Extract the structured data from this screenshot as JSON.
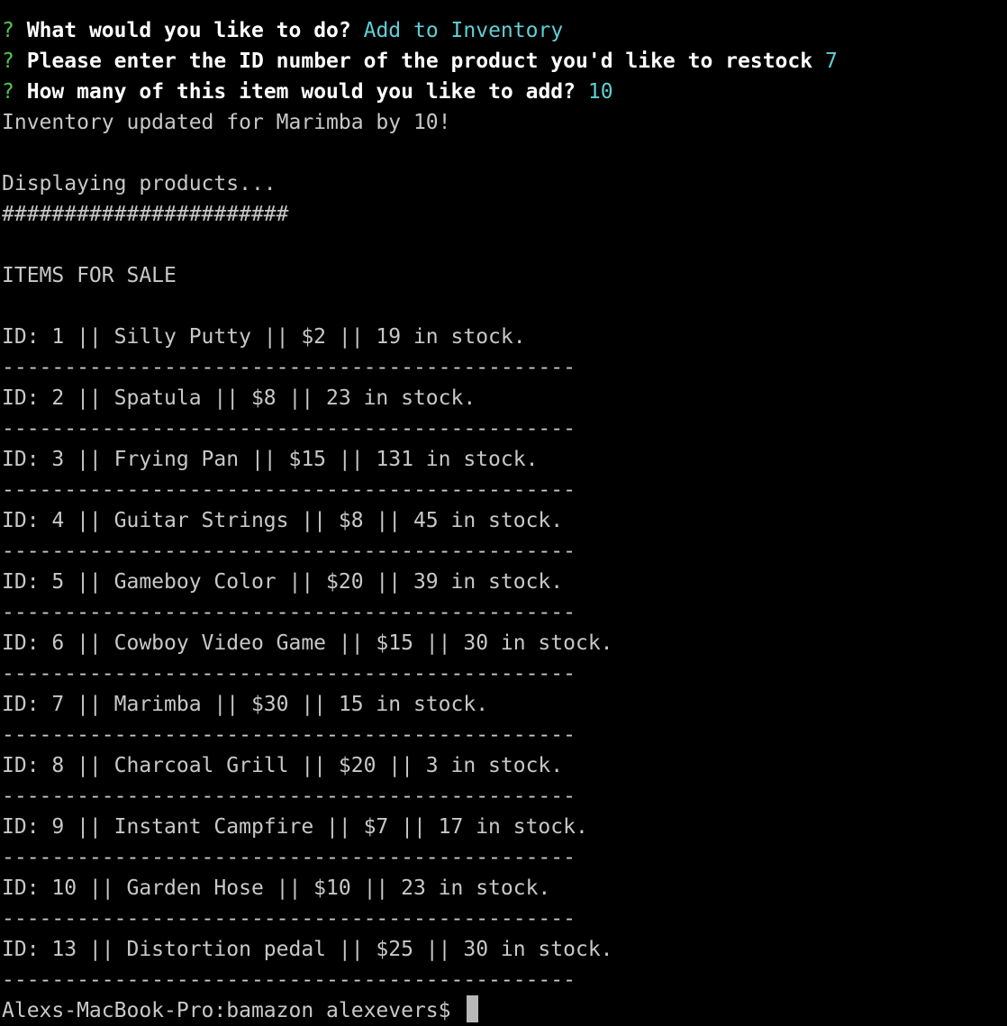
{
  "prompts": [
    {
      "mark": "?",
      "question": "What would you like to do?",
      "answer": "Add to Inventory"
    },
    {
      "mark": "?",
      "question": "Please enter the ID number of the product you'd like to restock",
      "answer": "7"
    },
    {
      "mark": "?",
      "question": "How many of this item would you like to add?",
      "answer": "10"
    }
  ],
  "update_message": "Inventory updated for Marimba by 10!",
  "displaying_text": "Displaying products...",
  "hash_line": "#######################",
  "items_header": "ITEMS FOR SALE",
  "separator": "----------------------------------------------",
  "products": [
    "ID: 1 || Silly Putty || $2 || 19 in stock.",
    "ID: 2 || Spatula || $8 || 23 in stock.",
    "ID: 3 || Frying Pan || $15 || 131 in stock.",
    "ID: 4 || Guitar Strings || $8 || 45 in stock.",
    "ID: 5 || Gameboy Color || $20 || 39 in stock.",
    "ID: 6 || Cowboy Video Game || $15 || 30 in stock.",
    "ID: 7 || Marimba || $30 || 15 in stock.",
    "ID: 8 || Charcoal Grill || $20 || 3 in stock.",
    "ID: 9 || Instant Campfire || $7 || 17 in stock.",
    "ID: 10 || Garden Hose || $10 || 23 in stock.",
    "ID: 13 || Distortion pedal || $25 || 30 in stock."
  ],
  "shell_prompt": "Alexs-MacBook-Pro:bamazon alexevers$"
}
